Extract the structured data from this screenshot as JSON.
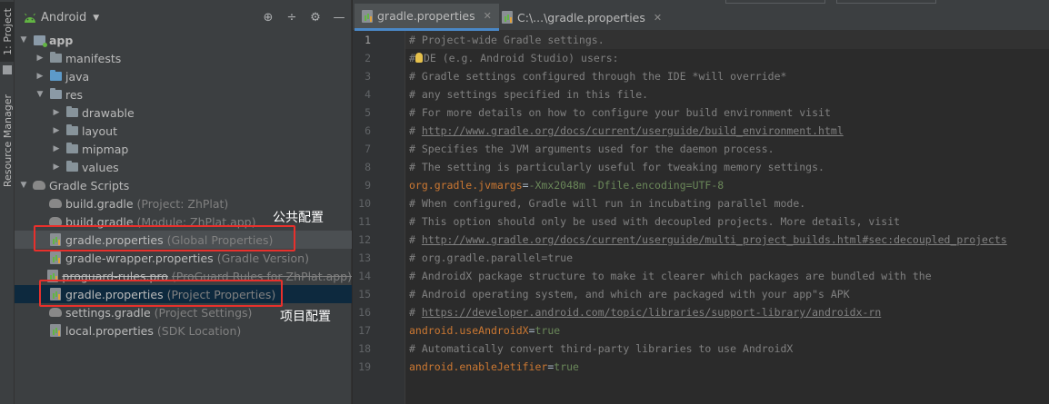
{
  "tool_strip": {
    "project_tab": "1: Project",
    "resource_tab": "Resource Manager"
  },
  "project_panel": {
    "view_selector": "Android",
    "header_icons": [
      "locate-icon",
      "collapse-icon",
      "gear-icon",
      "minimize-icon"
    ],
    "tree": [
      {
        "id": "app",
        "label": "app",
        "hint": "",
        "indent": 0,
        "arrow": "down",
        "icon": "app-module-icon",
        "bold": true
      },
      {
        "id": "manifests",
        "label": "manifests",
        "hint": "",
        "indent": 1,
        "arrow": "right",
        "icon": "folder-icon"
      },
      {
        "id": "java",
        "label": "java",
        "hint": "",
        "indent": 1,
        "arrow": "right",
        "icon": "blue-folder-icon"
      },
      {
        "id": "res",
        "label": "res",
        "hint": "",
        "indent": 1,
        "arrow": "down",
        "icon": "res-folder-icon"
      },
      {
        "id": "drawable",
        "label": "drawable",
        "hint": "",
        "indent": 2,
        "arrow": "right",
        "icon": "folder-icon"
      },
      {
        "id": "layout",
        "label": "layout",
        "hint": "",
        "indent": 2,
        "arrow": "right",
        "icon": "folder-icon"
      },
      {
        "id": "mipmap",
        "label": "mipmap",
        "hint": "",
        "indent": 2,
        "arrow": "right",
        "icon": "folder-icon"
      },
      {
        "id": "values",
        "label": "values",
        "hint": "",
        "indent": 2,
        "arrow": "right",
        "icon": "folder-icon"
      },
      {
        "id": "gradle-scripts",
        "label": "Gradle Scripts",
        "hint": "",
        "indent": 0,
        "arrow": "down",
        "icon": "gradle-elephant-icon"
      },
      {
        "id": "build-gradle-project",
        "label": "build.gradle",
        "hint": "(Project: ZhPlat)",
        "indent": 1,
        "arrow": "",
        "icon": "gradle-elephant-icon"
      },
      {
        "id": "build-gradle-module",
        "label": "build.gradle",
        "hint": "(Module: ZhPlat.app)",
        "indent": 1,
        "arrow": "",
        "icon": "gradle-elephant-icon"
      },
      {
        "id": "gradle-properties-global",
        "label": "gradle.properties",
        "hint": "(Global Properties)",
        "indent": 1,
        "arrow": "",
        "icon": "properties-file-icon",
        "highlight": "gray"
      },
      {
        "id": "gradle-wrapper-properties",
        "label": "gradle-wrapper.properties",
        "hint": "(Gradle Version)",
        "indent": 1,
        "arrow": "",
        "icon": "properties-file-icon"
      },
      {
        "id": "proguard-rules",
        "label": "proguard-rules.pro",
        "hint": "(ProGuard Rules for ZhPlat.app)",
        "indent": 1,
        "arrow": "",
        "icon": "properties-file-icon",
        "strike": true
      },
      {
        "id": "gradle-properties-project",
        "label": "gradle.properties",
        "hint": "(Project Properties)",
        "indent": 1,
        "arrow": "",
        "icon": "properties-file-icon",
        "highlight": "blue"
      },
      {
        "id": "settings-gradle",
        "label": "settings.gradle",
        "hint": "(Project Settings)",
        "indent": 1,
        "arrow": "",
        "icon": "gradle-elephant-icon"
      },
      {
        "id": "local-properties",
        "label": "local.properties",
        "hint": "(SDK Location)",
        "indent": 1,
        "arrow": "",
        "icon": "properties-file-icon"
      }
    ]
  },
  "annotations": {
    "global_label": "公共配置",
    "project_label": "项目配置",
    "box_color": "#e8302c"
  },
  "editor": {
    "tabs": [
      {
        "label": "gradle.properties",
        "active": true
      },
      {
        "label": "C:\\...\\gradle.properties",
        "active": false
      }
    ],
    "current_line": 1,
    "lines": [
      [
        {
          "t": "cmt",
          "s": "# Project-wide Gradle settings."
        }
      ],
      [
        {
          "t": "cmt",
          "s": "#"
        },
        {
          "t": "bulb",
          "s": ""
        },
        {
          "t": "cmt",
          "s": "DE (e.g. Android Studio) users:"
        }
      ],
      [
        {
          "t": "cmt",
          "s": "# Gradle settings configured through the IDE *will override*"
        }
      ],
      [
        {
          "t": "cmt",
          "s": "# any settings specified in this file."
        }
      ],
      [
        {
          "t": "cmt",
          "s": "# For more details on how to configure your build environment visit"
        }
      ],
      [
        {
          "t": "cmt",
          "s": "# "
        },
        {
          "t": "link",
          "s": "http://www.gradle.org/docs/current/userguide/build_environment.html"
        }
      ],
      [
        {
          "t": "cmt",
          "s": "# Specifies the JVM arguments used for the daemon process."
        }
      ],
      [
        {
          "t": "cmt",
          "s": "# The setting is particularly useful for tweaking memory settings."
        }
      ],
      [
        {
          "t": "key",
          "s": "org.gradle.jvmargs"
        },
        {
          "t": "eq",
          "s": "="
        },
        {
          "t": "val",
          "s": "-Xmx2048m -Dfile.encoding=UTF-8"
        }
      ],
      [
        {
          "t": "cmt",
          "s": "# When configured, Gradle will run in incubating parallel mode."
        }
      ],
      [
        {
          "t": "cmt",
          "s": "# This option should only be used with decoupled projects. More details, visit"
        }
      ],
      [
        {
          "t": "cmt",
          "s": "# "
        },
        {
          "t": "link",
          "s": "http://www.gradle.org/docs/current/userguide/multi_project_builds.html#sec:decoupled_projects"
        }
      ],
      [
        {
          "t": "cmt",
          "s": "# org.gradle.parallel=true"
        }
      ],
      [
        {
          "t": "cmt",
          "s": "# AndroidX package structure to make it clearer which packages are bundled with the"
        }
      ],
      [
        {
          "t": "cmt",
          "s": "# Android operating system, and which are packaged with your app\"s APK"
        }
      ],
      [
        {
          "t": "cmt",
          "s": "# "
        },
        {
          "t": "link",
          "s": "https://developer.android.com/topic/libraries/support-library/androidx-rn"
        }
      ],
      [
        {
          "t": "key",
          "s": "android.useAndroidX"
        },
        {
          "t": "eq",
          "s": "="
        },
        {
          "t": "val",
          "s": "true"
        }
      ],
      [
        {
          "t": "cmt",
          "s": "# Automatically convert third-party libraries to use AndroidX"
        }
      ],
      [
        {
          "t": "key",
          "s": "android.enableJetifier"
        },
        {
          "t": "eq",
          "s": "="
        },
        {
          "t": "val",
          "s": "true"
        }
      ]
    ]
  }
}
